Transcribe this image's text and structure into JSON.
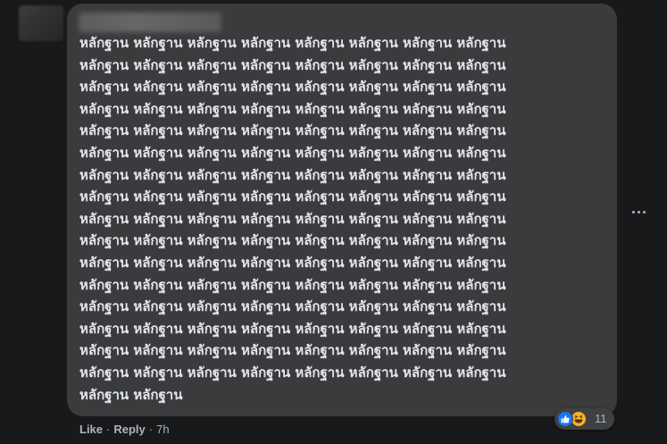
{
  "comment": {
    "author_name": "",
    "lines": [
      "หลักฐาน หลักฐาน หลักฐาน หลักฐาน หลักฐาน หลักฐาน หลักฐาน หลักฐาน",
      "หลักฐาน หลักฐาน หลักฐาน หลักฐาน หลักฐาน หลักฐาน หลักฐาน หลักฐาน",
      "หลักฐาน หลักฐาน หลักฐาน หลักฐาน หลักฐาน หลักฐาน หลักฐาน หลักฐาน",
      "หลักฐาน หลักฐาน หลักฐาน หลักฐาน หลักฐาน หลักฐาน หลักฐาน หลักฐาน",
      "หลักฐาน หลักฐาน หลักฐาน หลักฐาน หลักฐาน หลักฐาน หลักฐาน หลักฐาน",
      "หลักฐาน หลักฐาน หลักฐาน หลักฐาน หลักฐาน หลักฐาน หลักฐาน หลักฐาน",
      "หลักฐาน หลักฐาน หลักฐาน หลักฐาน หลักฐาน หลักฐาน หลักฐาน หลักฐาน",
      "หลักฐาน หลักฐาน หลักฐาน หลักฐาน หลักฐาน หลักฐาน หลักฐาน หลักฐาน",
      "หลักฐาน หลักฐาน หลักฐาน หลักฐาน หลักฐาน หลักฐาน หลักฐาน หลักฐาน",
      "หลักฐาน หลักฐาน หลักฐาน หลักฐาน หลักฐาน หลักฐาน หลักฐาน หลักฐาน",
      "หลักฐาน หลักฐาน หลักฐาน หลักฐาน หลักฐาน หลักฐาน หลักฐาน หลักฐาน",
      "หลักฐาน หลักฐาน หลักฐาน หลักฐาน หลักฐาน หลักฐาน หลักฐาน หลักฐาน",
      "หลักฐาน หลักฐาน หลักฐาน หลักฐาน หลักฐาน หลักฐาน หลักฐาน หลักฐาน",
      "หลักฐาน หลักฐาน หลักฐาน หลักฐาน หลักฐาน หลักฐาน หลักฐาน หลักฐาน",
      "หลักฐาน หลักฐาน หลักฐาน หลักฐาน หลักฐาน หลักฐาน หลักฐาน หลักฐาน",
      "หลักฐาน หลักฐาน หลักฐาน หลักฐาน หลักฐาน หลักฐาน หลักฐาน หลักฐาน",
      "หลักฐาน หลักฐาน"
    ]
  },
  "actions": {
    "like_label": "Like",
    "reply_label": "Reply",
    "separator": "·",
    "timestamp": "7h"
  },
  "reactions": {
    "icons": [
      "like-icon",
      "haha-icon"
    ],
    "count": "11"
  },
  "colors": {
    "background": "#18191a",
    "bubble": "#3a3b3c",
    "text_primary": "#e4e6eb",
    "text_secondary": "#b0b3b8",
    "like_blue": "#1877f2",
    "haha_yellow": "#f7b125"
  }
}
